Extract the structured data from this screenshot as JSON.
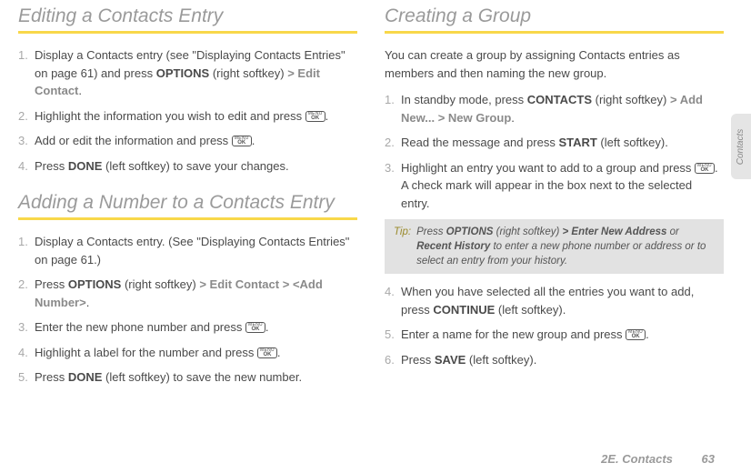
{
  "sideTab": "Contacts",
  "footer": {
    "section": "2E. Contacts",
    "page": "63"
  },
  "left": {
    "heading1": "Editing a Contacts Entry",
    "steps1": [
      {
        "n": "1.",
        "pre": "Display a Contacts entry (see \"Displaying Contacts Entries\" on page 61) and press ",
        "b1": "OPTIONS",
        "mid1": " (right softkey) ",
        "gt1": "> ",
        "g1": "Edit Contact",
        "post1": "."
      },
      {
        "n": "2.",
        "pre": "Highlight the information you wish to edit and press ",
        "icon": true,
        "post": "."
      },
      {
        "n": "3.",
        "pre": "Add or edit the information and press ",
        "icon": true,
        "post": "."
      },
      {
        "n": "4.",
        "pre": "Press ",
        "b1": "DONE",
        "post": " (left softkey) to save your changes."
      }
    ],
    "heading2": "Adding a Number to a Contacts Entry",
    "steps2": [
      {
        "n": "1.",
        "pre": "Display a Contacts entry. (See \"Displaying Contacts Entries\" on page 61.)"
      },
      {
        "n": "2.",
        "pre": "Press ",
        "b1": "OPTIONS",
        "mid1": " (right softkey) ",
        "gt1": "> ",
        "g1": "Edit Contact",
        "gt2": " > ",
        "g2": "<Add Number>",
        "post": "."
      },
      {
        "n": "3.",
        "pre": "Enter the new phone number and press ",
        "icon": true,
        "post": "."
      },
      {
        "n": "4.",
        "pre": "Highlight a label for the number and press ",
        "icon": true,
        "post": "."
      },
      {
        "n": "5.",
        "pre": "Press ",
        "b1": "DONE",
        "post": " (left softkey) to save the new number."
      }
    ]
  },
  "right": {
    "heading": "Creating a Group",
    "intro": "You can create a group by assigning Contacts entries as members and then naming the new group.",
    "stepsA": [
      {
        "n": "1.",
        "pre": "In standby mode, press ",
        "b1": "CONTACTS",
        "mid1": " (right softkey) ",
        "gt1": "> ",
        "g1": "Add New...",
        "gt2": " > ",
        "g2": "New Group",
        "post": "."
      },
      {
        "n": "2.",
        "pre": "Read the message and press ",
        "b1": "START",
        "post": " (left softkey)."
      },
      {
        "n": "3.",
        "pre": "Highlight an entry you want to add to a group and press ",
        "icon": true,
        "post": ". A check mark will appear in the box next to the selected entry."
      }
    ],
    "tip": {
      "label": "Tip:",
      "pre": "Press ",
      "b1": "OPTIONS",
      "mid1": " (right softkey) ",
      "gt1": "> ",
      "g1": "Enter New Address",
      "mid2": " or ",
      "g2": "Recent History",
      "post": " to enter a new phone number or address or to select an entry from your history."
    },
    "stepsB": [
      {
        "n": "4.",
        "pre": "When you have selected all the entries you want to add, press ",
        "b1": "CONTINUE",
        "post": " (left softkey)."
      },
      {
        "n": "5.",
        "pre": "Enter a name for the new group and press ",
        "icon": true,
        "post": "."
      },
      {
        "n": "6.",
        "pre": "Press ",
        "b1": "SAVE",
        "post": " (left softkey)."
      }
    ]
  }
}
